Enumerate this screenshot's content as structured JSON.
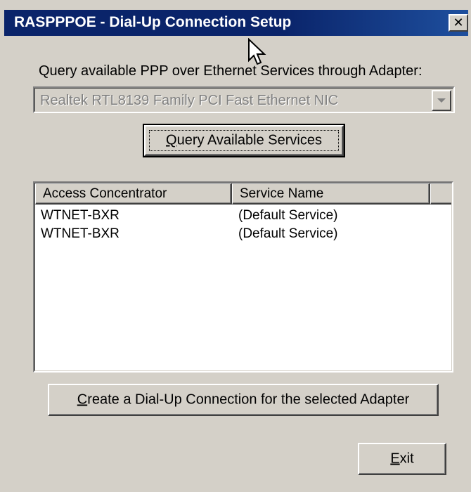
{
  "window": {
    "title": "RASPPPOE - Dial-Up Connection Setup",
    "close_label": "✕"
  },
  "query_label": "Query available PPP over Ethernet Services through Adapter:",
  "adapter_select": {
    "value": "Realtek RTL8139 Family PCI Fast Ethernet NIC",
    "enabled": false
  },
  "buttons": {
    "query_prefix": "",
    "query_accel": "Q",
    "query_rest": "uery Available Services",
    "create_accel": "C",
    "create_rest": "reate a Dial-Up Connection for the selected Adapter",
    "exit_accel": "E",
    "exit_rest": "xit"
  },
  "list": {
    "columns": [
      "Access Concentrator",
      "Service Name",
      ""
    ],
    "rows": [
      {
        "access_concentrator": "WTNET-BXR",
        "service_name": "(Default Service)"
      },
      {
        "access_concentrator": "WTNET-BXR",
        "service_name": "(Default Service)"
      }
    ]
  },
  "colors": {
    "titlebar": "#0a246a",
    "face": "#d4d0c8",
    "disabled_text": "#808080"
  },
  "icons": [
    "close-icon",
    "dropdown-arrow-icon",
    "mouse-cursor-icon"
  ]
}
